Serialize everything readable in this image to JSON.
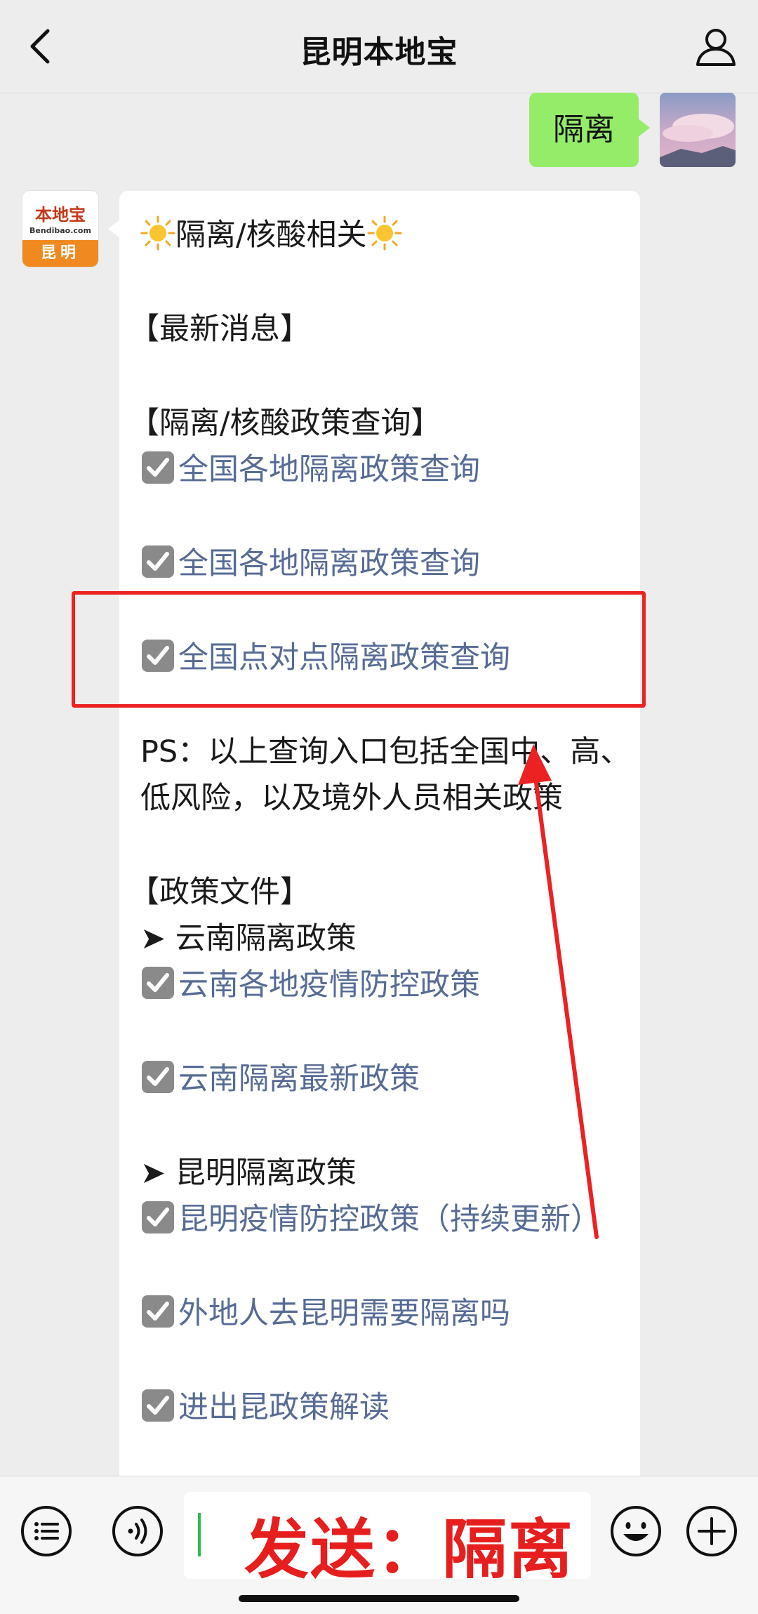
{
  "header": {
    "title": "昆明本地宝",
    "back_icon": "chevron-left-icon",
    "profile_icon": "person-icon"
  },
  "outgoing": {
    "text": "隔离"
  },
  "bot_avatar": {
    "brand": "本地宝",
    "url": "Bendibao.com",
    "city": "昆明"
  },
  "message": {
    "title": "隔离/核酸相关",
    "latest_news": "【最新消息】",
    "policy_query_header": "【隔离/核酸政策查询】",
    "link1": "全国各地隔离政策查询",
    "link2": "全国各地隔离政策查询",
    "link3": "全国点对点隔离政策查询",
    "ps_line1": "PS：以上查询入口包括全国中、高、",
    "ps_line2": "低风险，以及境外人员相关政策",
    "docs_header": "【政策文件】",
    "yunnan_header": "➤ 云南隔离政策",
    "link4": "云南各地疫情防控政策",
    "link5": "云南隔离最新政策",
    "kunming_header": "➤ 昆明隔离政策",
    "link6": "昆明疫情防控政策（持续更新）",
    "link7": "外地人去昆明需要隔离吗",
    "link8": "进出昆政策解读"
  },
  "input": {
    "text": "发送：隔离"
  },
  "bottombar": {
    "menu_icon": "list-icon",
    "voice_icon": "voice-icon",
    "emoji_icon": "emoji-icon",
    "plus_icon": "plus-icon"
  },
  "colors": {
    "link": "#576b95",
    "outgoing_bubble": "#95ec69",
    "highlight": "#ec2222"
  }
}
